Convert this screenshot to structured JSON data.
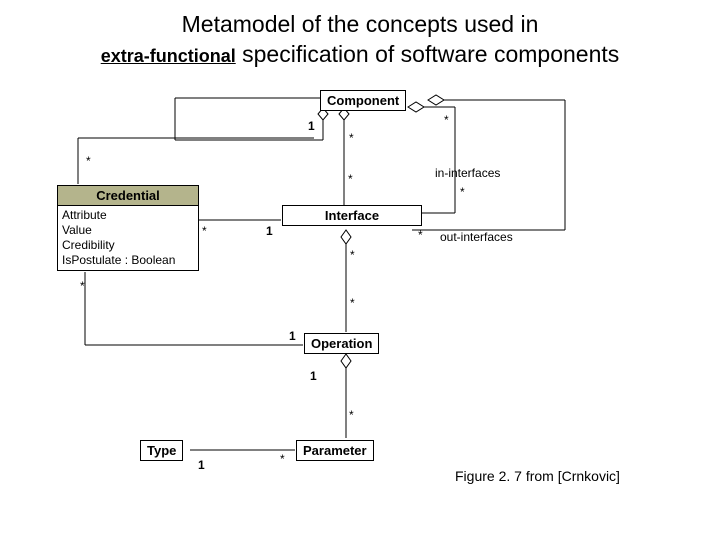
{
  "title": {
    "line1": "Metamodel of the concepts used in",
    "emph": "extra-functional",
    "line2_rest": " specification of software components"
  },
  "classes": {
    "component": "Component",
    "credential": "Credential",
    "interface": "Interface",
    "operation": "Operation",
    "type": "Type",
    "parameter": "Parameter"
  },
  "credentialAttrs": {
    "attribute": "Attribute",
    "value": "Value",
    "credibility": "Credibility",
    "ispostulate": "IsPostulate : Boolean"
  },
  "assoc": {
    "inIfaces": "in-interfaces",
    "outIfaces": "out-interfaces"
  },
  "mult": {
    "one": "1",
    "star": "*"
  },
  "caption": "Figure 2. 7 from [Crnkovic]"
}
